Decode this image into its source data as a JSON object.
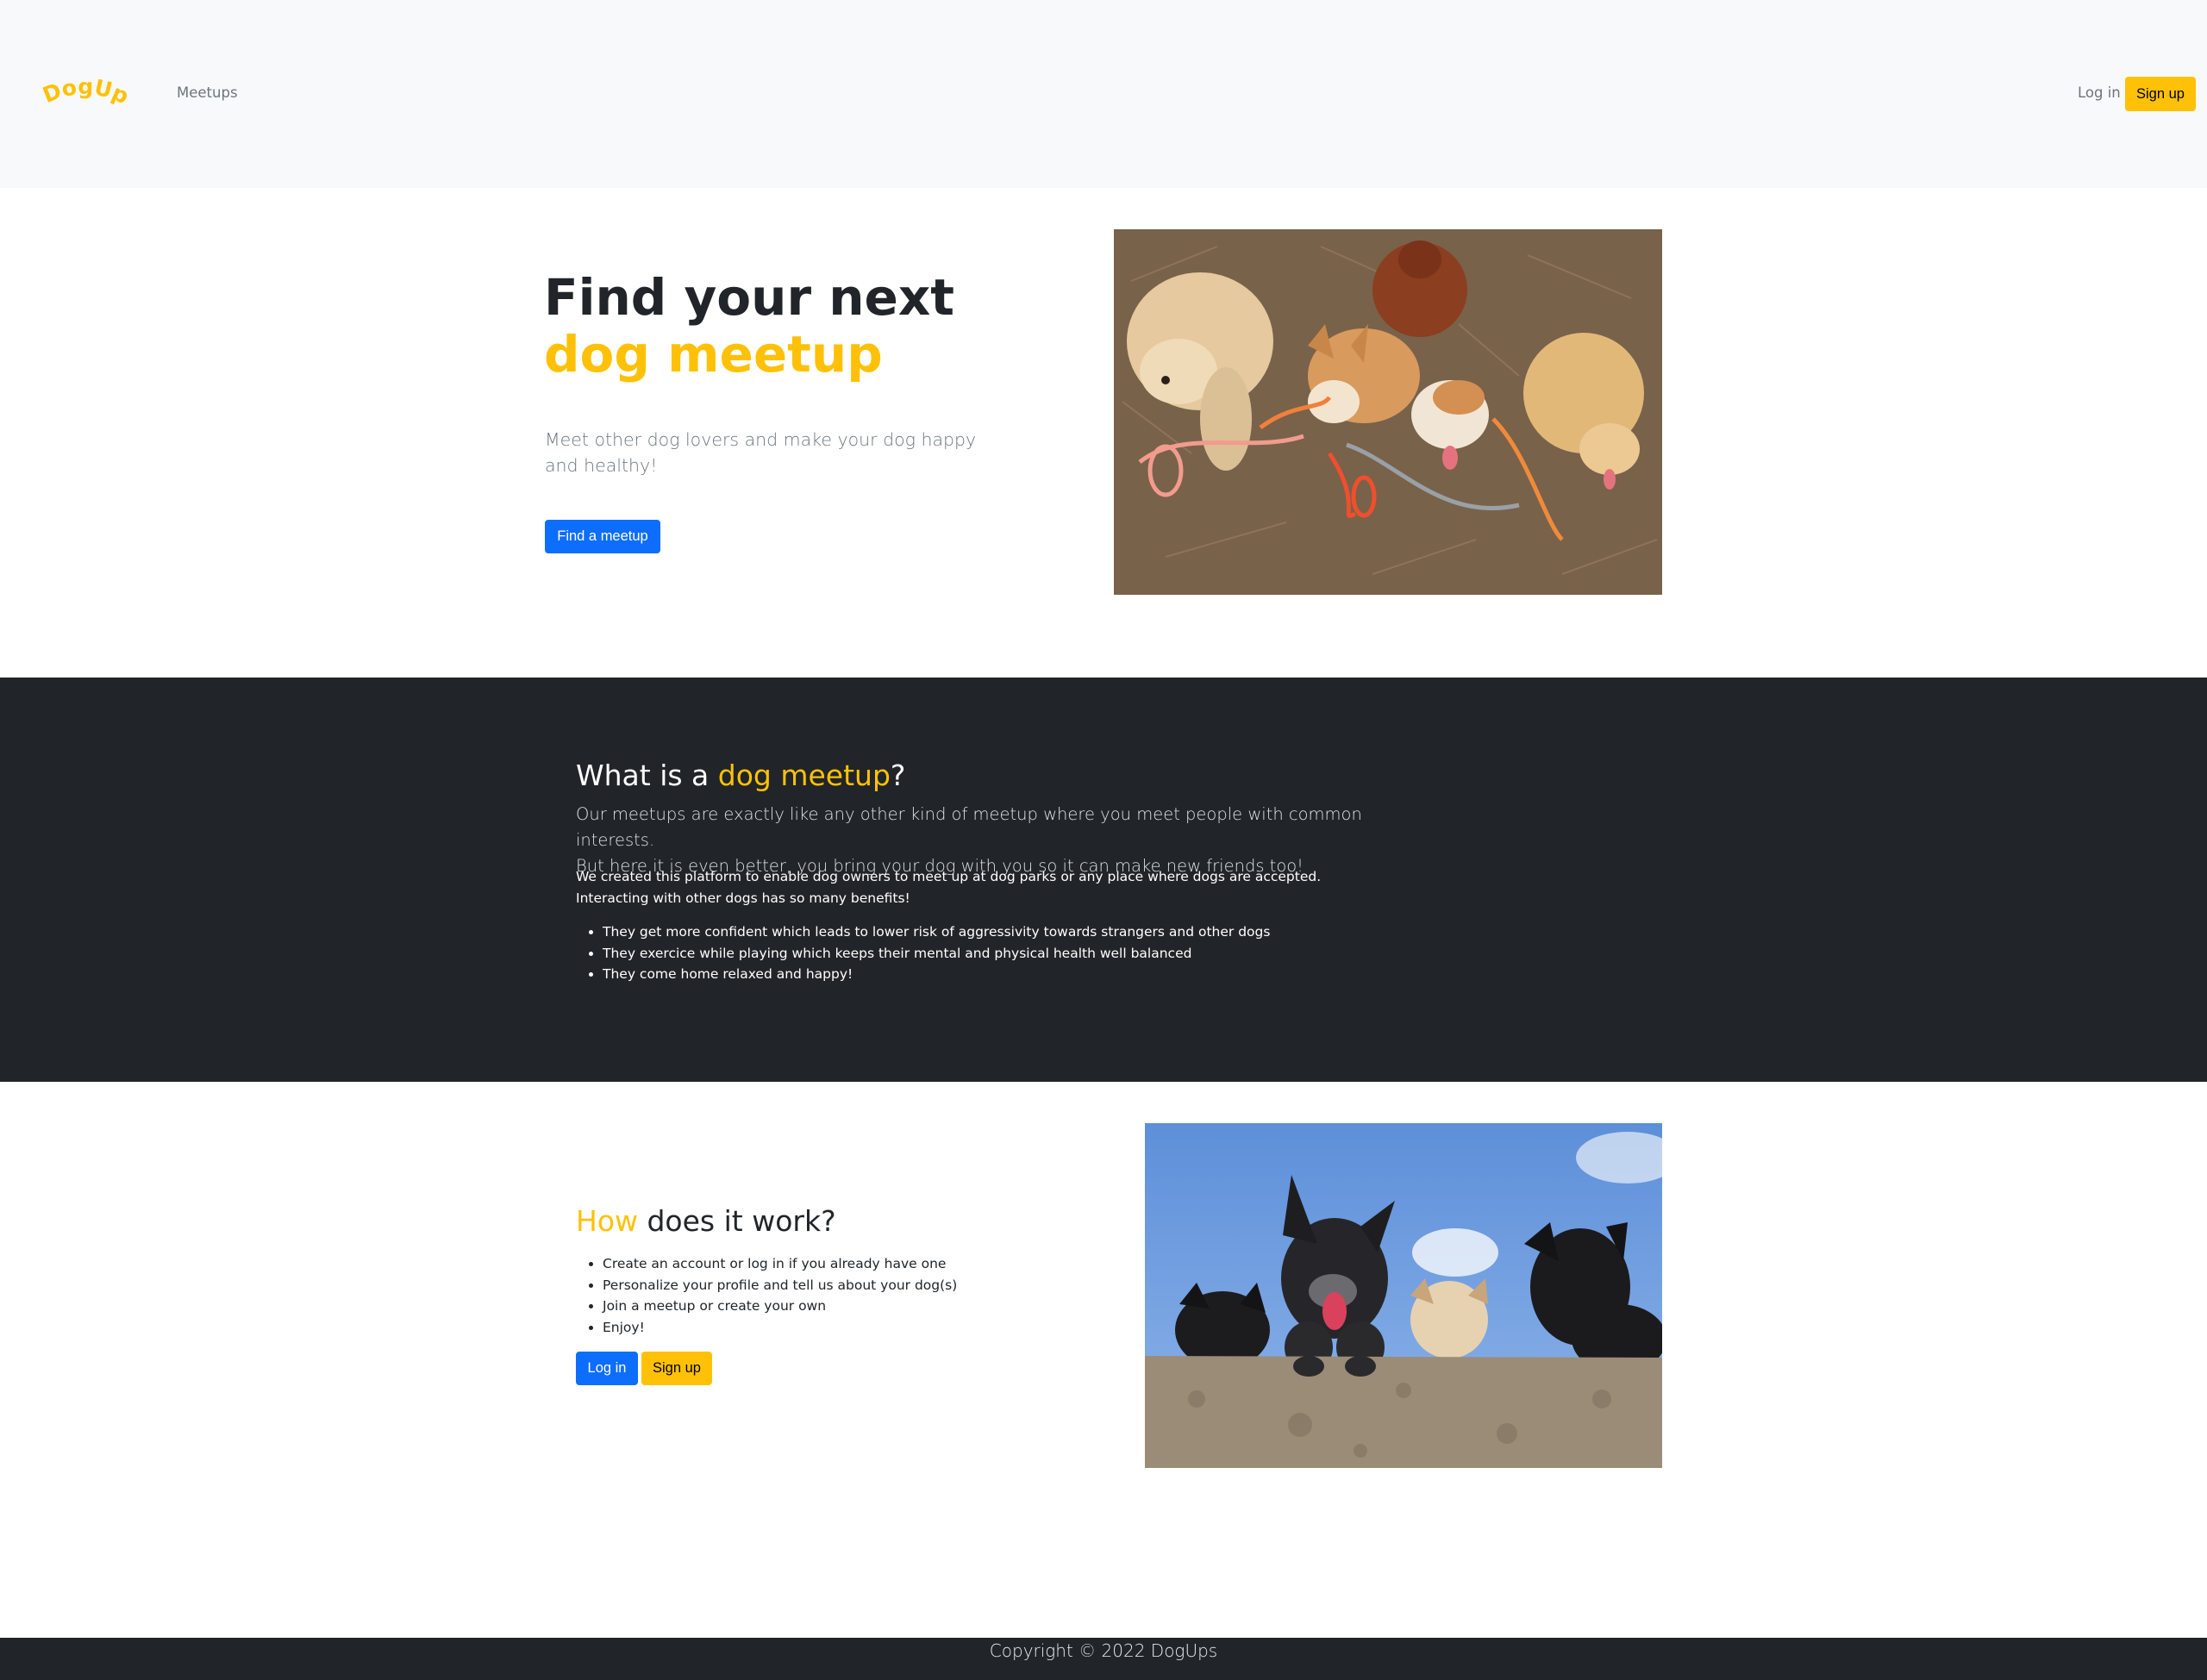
{
  "brand": {
    "logo_text": "DogUps",
    "accent_color": "#ffc107"
  },
  "nav": {
    "meetups": "Meetups",
    "login": "Log in",
    "signup": "Sign up"
  },
  "hero": {
    "title_part1": "Find your next ",
    "title_accent": "dog meetup",
    "subtitle": "Meet other dog lovers and make your dog happy and healthy!",
    "cta": "Find a meetup"
  },
  "about": {
    "title_pre": "What is a ",
    "title_accent": "dog meetup",
    "title_post": "?",
    "lead_line1": "Our meetups are exactly like any other kind of meetup where you meet people with common interests.",
    "lead_line2": "But here it is even better, you bring your dog with you so it can make new friends too!",
    "text_line1": "We created this platform to enable dog owners to meet up at dog parks or any place where dogs are accepted.",
    "text_line2": "Interacting with other dogs has so many benefits!",
    "benefits": [
      "They get more confident which leads to lower risk of aggressivity towards strangers and other dogs",
      "They exercice while playing which keeps their mental and physical health well balanced",
      "They come home relaxed and happy!"
    ]
  },
  "how": {
    "title_accent": "How",
    "title_rest": " does it work?",
    "steps": [
      "Create an account or log in if you already have one",
      "Personalize your profile and tell us about your dog(s)",
      "Join a meetup or create your own",
      "Enjoy!"
    ],
    "login": "Log in",
    "signup": "Sign up"
  },
  "footer": {
    "copyright": "Copyright © 2022 DogUps"
  }
}
